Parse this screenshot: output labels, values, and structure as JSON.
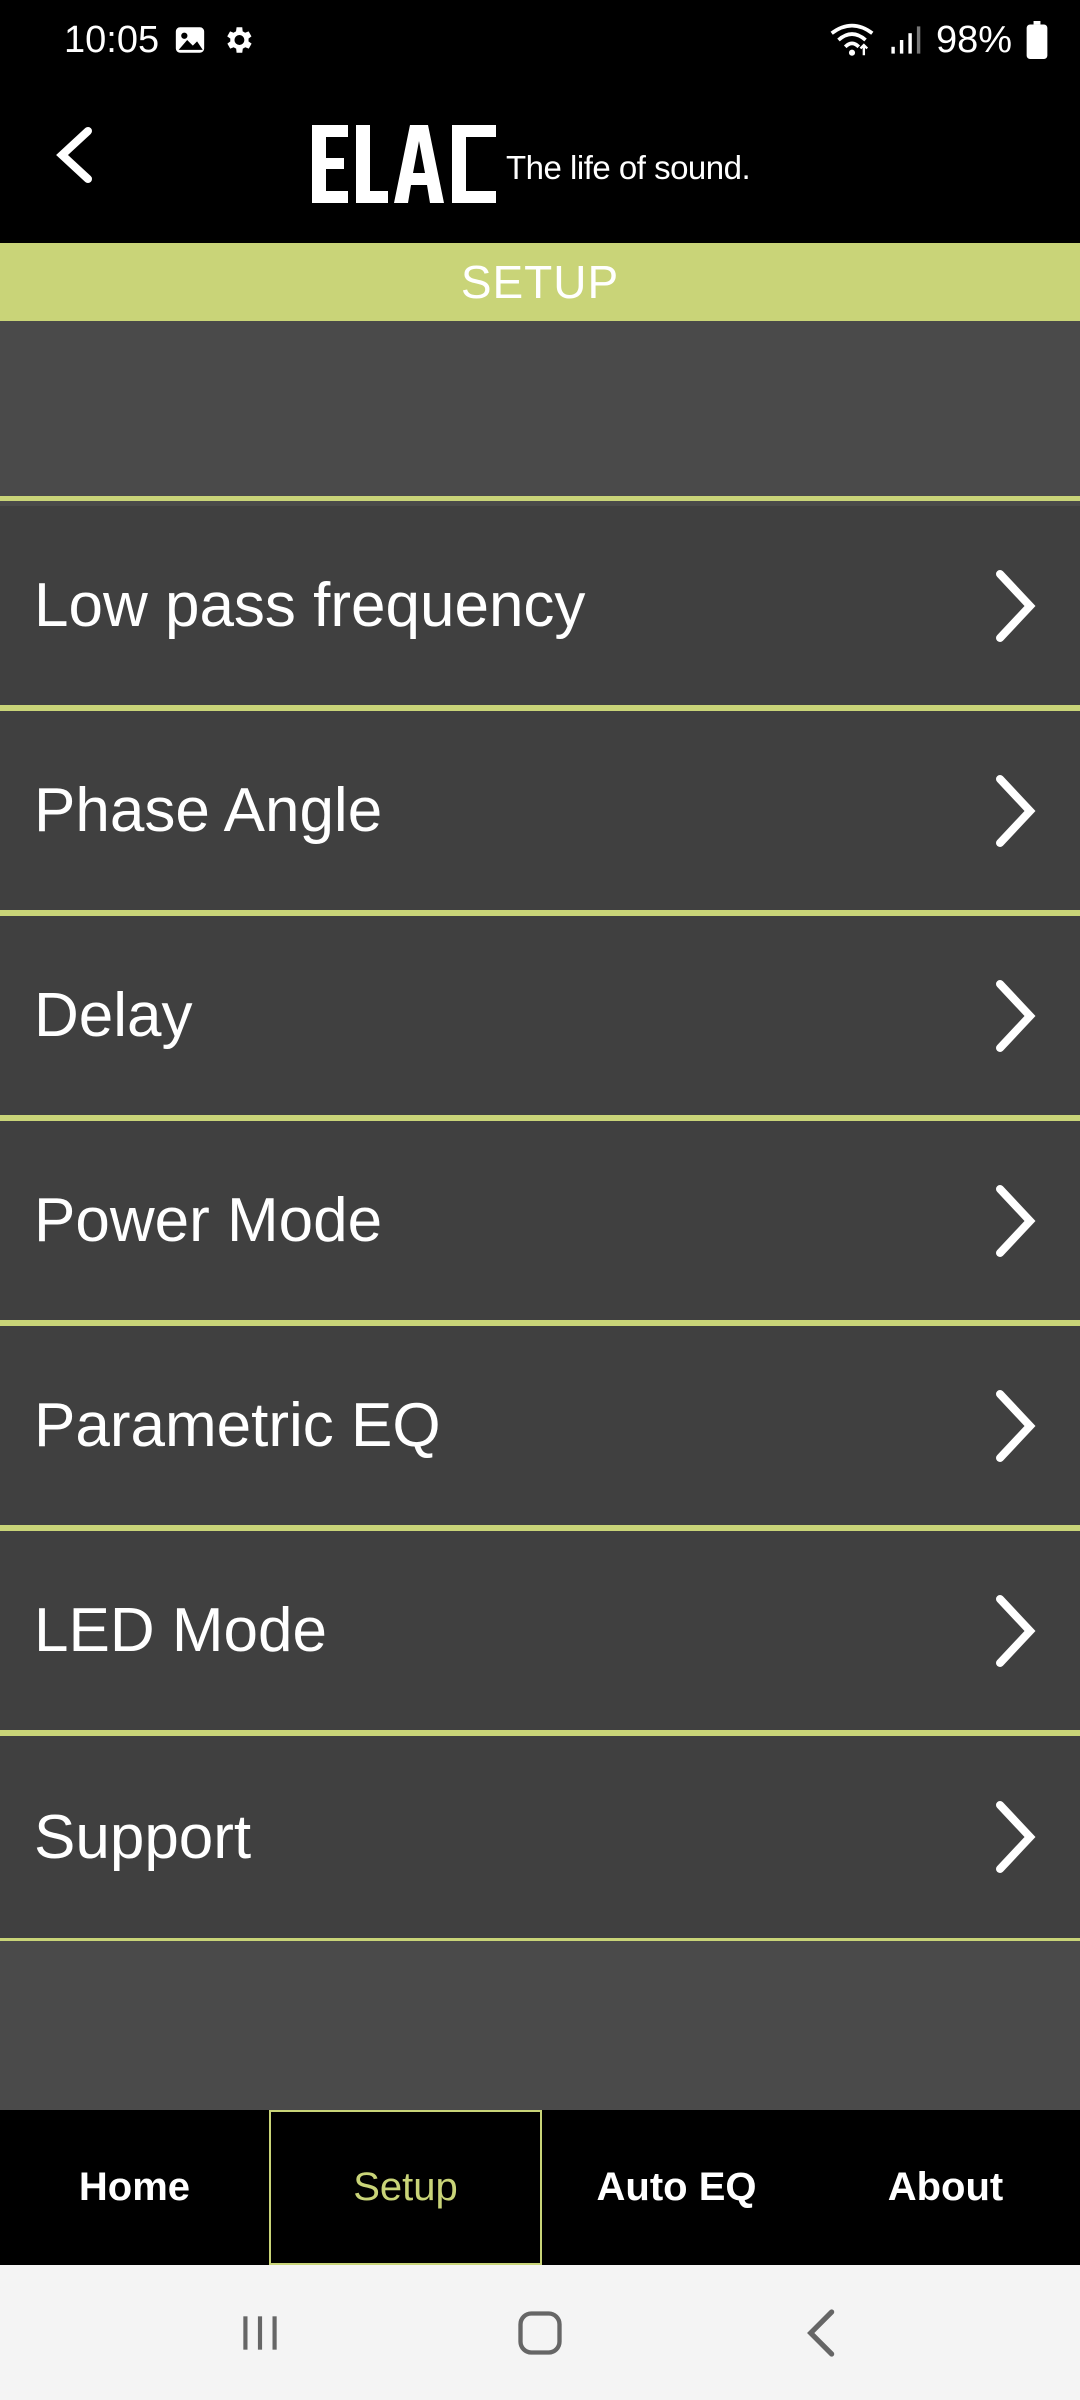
{
  "status_bar": {
    "time": "10:05",
    "battery": "98%",
    "icons_left": [
      "image-icon",
      "gear-icon"
    ],
    "icons_right": [
      "wifi-icon",
      "signal-icon",
      "battery-icon"
    ]
  },
  "header": {
    "brand": "ELAC",
    "tagline": "The life of sound."
  },
  "section": {
    "title": "SETUP"
  },
  "menu": {
    "items": [
      {
        "label": "Low pass frequency"
      },
      {
        "label": "Phase Angle"
      },
      {
        "label": "Delay"
      },
      {
        "label": "Power Mode"
      },
      {
        "label": "Parametric EQ"
      },
      {
        "label": "LED Mode"
      },
      {
        "label": "Support"
      }
    ]
  },
  "tabs": [
    {
      "label": "Home"
    },
    {
      "label": "Setup",
      "active": true
    },
    {
      "label": "Auto EQ"
    },
    {
      "label": "About"
    }
  ],
  "colors": {
    "accent": "#c9d478",
    "header_bg": "#000000",
    "item_bg": "#404040",
    "page_bg": "#4a4a4a"
  }
}
